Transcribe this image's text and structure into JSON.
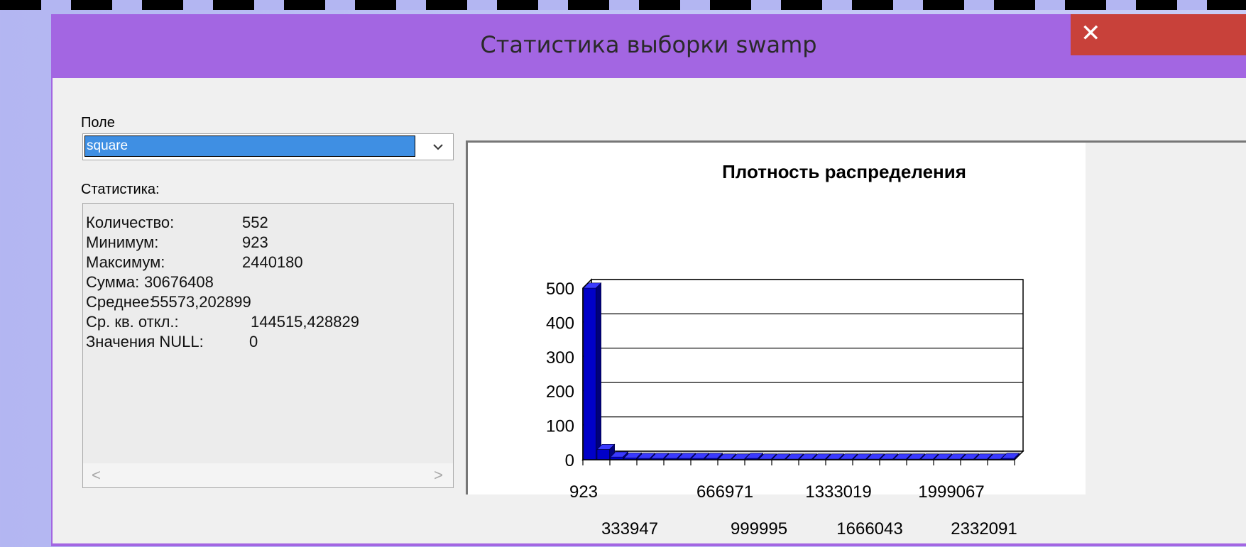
{
  "window": {
    "title": "Статистика выборки swamp",
    "close_label": "✕"
  },
  "field": {
    "label": "Поле",
    "value": "square"
  },
  "stats": {
    "label": "Статистика:",
    "rows": [
      {
        "name": "Количество:",
        "value": "552"
      },
      {
        "name": "Минимум:",
        "value": "923"
      },
      {
        "name": "Максимум:",
        "value": "2440180"
      },
      {
        "name": "Сумма:",
        "value": "30676408"
      },
      {
        "name": "Среднее:",
        "value": "55573,202899"
      },
      {
        "name": "Ср. кв. откл.:",
        "value": "144515,428829"
      },
      {
        "name": "Значения NULL:",
        "value": "0"
      }
    ]
  },
  "icons": {
    "dropdown": "chevron-down-icon",
    "close": "close-icon",
    "scroll_left": "chevron-left-icon",
    "scroll_right": "chevron-right-icon"
  },
  "colors": {
    "window_chrome": "#a366e2",
    "close_button": "#c8413a",
    "selection": "#3f8fe3",
    "bar": "#0000c8"
  },
  "chart_data": {
    "type": "bar",
    "title": "Плотность распределения",
    "xlabel": "",
    "ylabel": "",
    "ylim": [
      0,
      500
    ],
    "yticks": [
      0,
      100,
      200,
      300,
      400,
      500
    ],
    "xtick_labels_row1": [
      "923",
      "666971",
      "1333019",
      "1999067"
    ],
    "xtick_labels_row2": [
      "333947",
      "999995",
      "1666043",
      "2332091"
    ],
    "values": [
      500,
      30,
      8,
      5,
      3,
      2,
      1,
      1,
      1,
      1,
      0,
      0,
      1,
      0,
      0,
      0,
      0,
      0,
      0,
      0,
      0,
      0,
      0,
      0,
      0,
      0,
      0,
      0,
      0,
      0,
      0,
      1
    ],
    "grid": true,
    "style": "3d"
  }
}
